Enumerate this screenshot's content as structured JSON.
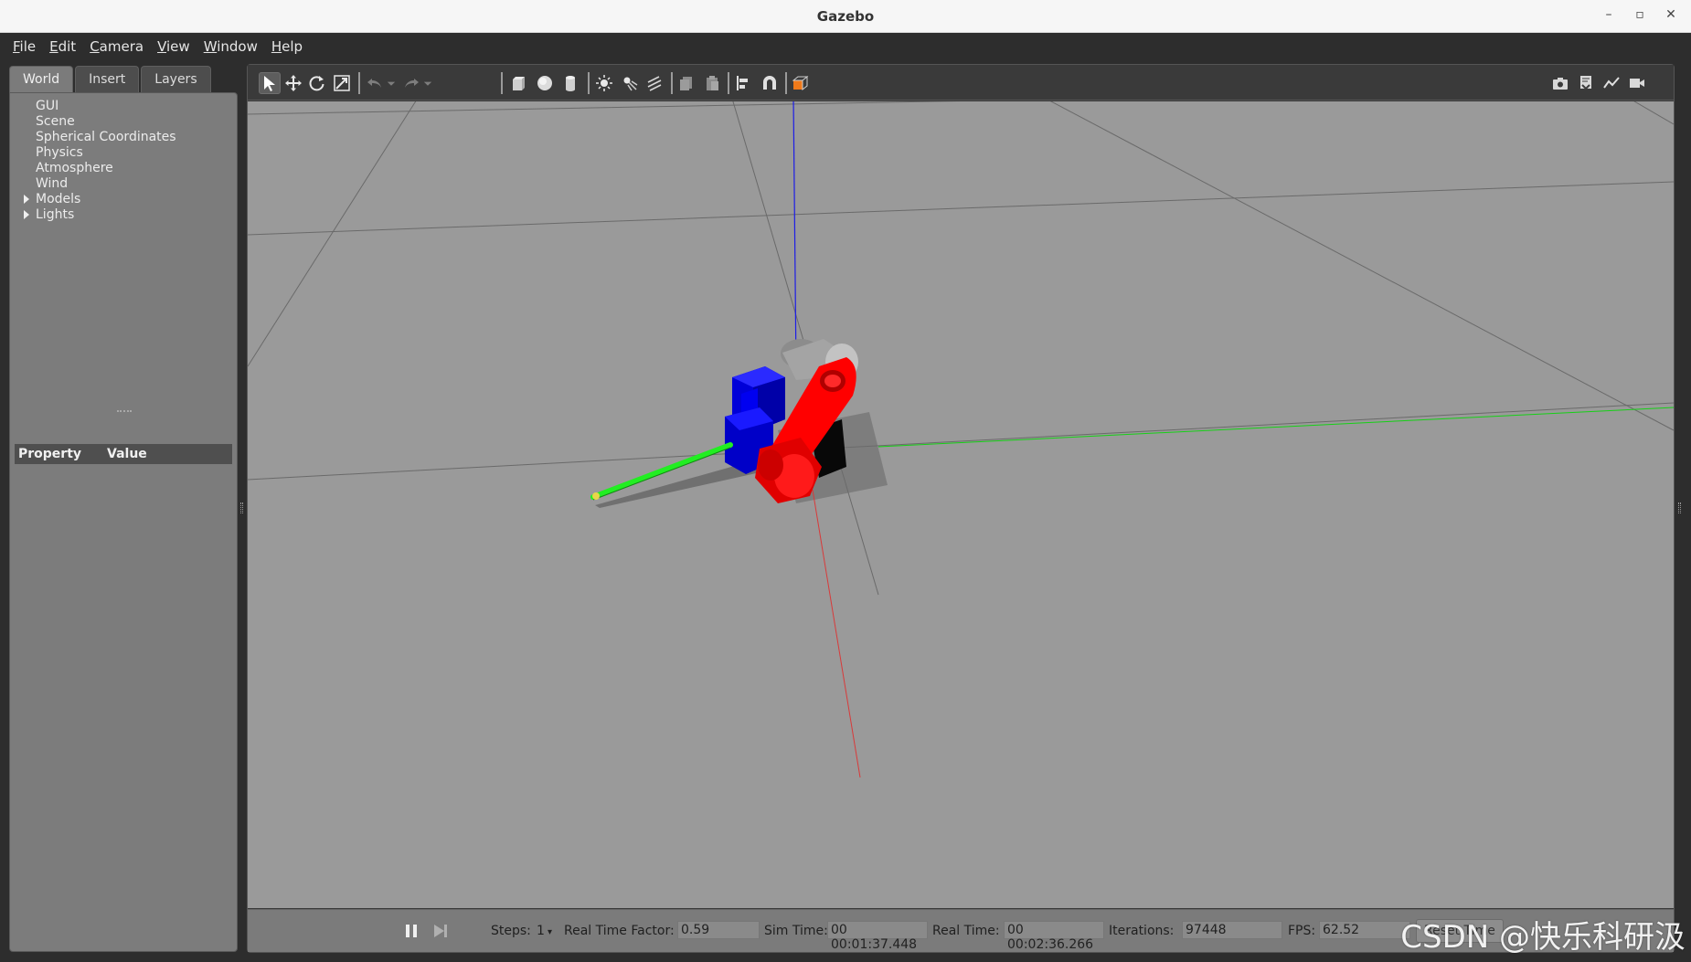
{
  "window": {
    "title": "Gazebo",
    "buttons": [
      "–",
      "▫",
      "✕"
    ]
  },
  "menu": {
    "items": [
      {
        "first": "F",
        "rest": "ile"
      },
      {
        "first": "E",
        "rest": "dit"
      },
      {
        "first": "C",
        "rest": "amera"
      },
      {
        "first": "V",
        "rest": "iew"
      },
      {
        "first": "W",
        "rest": "indow"
      },
      {
        "first": "H",
        "rest": "elp"
      }
    ]
  },
  "left_panel": {
    "tabs": [
      "World",
      "Insert",
      "Layers"
    ],
    "active_tab": "World",
    "tree": [
      "GUI",
      "Scene",
      "Spherical Coordinates",
      "Physics",
      "Atmosphere",
      "Wind",
      "Models",
      "Lights"
    ],
    "property_header": {
      "property": "Property",
      "value": "Value"
    }
  },
  "toolbar": {
    "tools": [
      "select-mode-icon",
      "translate-mode-icon",
      "rotate-mode-icon",
      "scale-mode-icon",
      "undo-icon",
      "undo-dropdown-icon",
      "redo-icon",
      "redo-dropdown-icon",
      "box-shape-icon",
      "sphere-shape-icon",
      "cylinder-shape-icon",
      "point-light-icon",
      "spot-light-icon",
      "directional-light-icon",
      "copy-icon",
      "paste-icon",
      "align-icon",
      "snap-magnet-icon",
      "view-angle-icon"
    ],
    "right_tools": [
      "screenshot-icon",
      "log-icon",
      "plot-icon",
      "video-record-icon"
    ]
  },
  "status": {
    "steps_label": "Steps:",
    "steps_value": "1",
    "rtf_label": "Real Time Factor:",
    "rtf_value": "0.59",
    "sim_label": "Sim Time:",
    "sim_value": "00 00:01:37.448",
    "real_label": "Real Time:",
    "real_value": "00 00:02:36.266",
    "iter_label": "Iterations:",
    "iter_value": "97448",
    "fps_label": "FPS:",
    "fps_value": "62.52",
    "reset_label": "Reset Time"
  },
  "watermark": "CSDN @快乐科研汲",
  "colors": {
    "viewport_bg": "#9a9a9a",
    "panel_bg": "#7c7c7c",
    "x_axis": "#e03030",
    "y_axis": "#00e000",
    "z_axis": "#2020e0",
    "robot_red": "#ff0000",
    "robot_blue": "#0000ff"
  }
}
